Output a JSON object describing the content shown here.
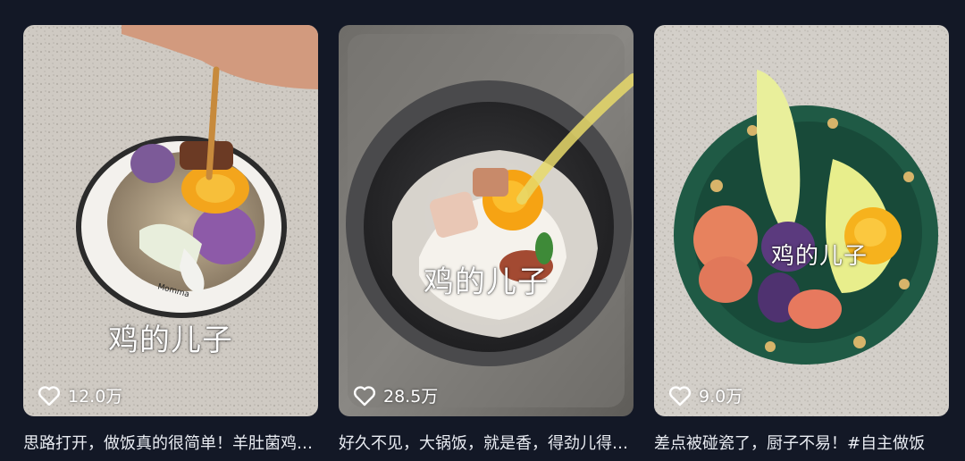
{
  "feed": {
    "items": [
      {
        "overlay_text": "鸡的儿子",
        "likes": "12.0万",
        "caption": "思路打开，做饭真的很简单！羊肚菌鸡蛋拌饭"
      },
      {
        "overlay_text": "鸡的儿子",
        "likes": "28.5万",
        "caption": "好久不见，大锅饭，就是香，得劲儿得劲儿"
      },
      {
        "overlay_text": "鸡的儿子",
        "likes": "9.0万",
        "caption": "差点被碰瓷了，厨子不易！#自主做饭"
      }
    ]
  },
  "colors": {
    "background": "#131826",
    "text": "#e9ecf2"
  },
  "icons": {
    "like": "heart-outline-icon"
  }
}
